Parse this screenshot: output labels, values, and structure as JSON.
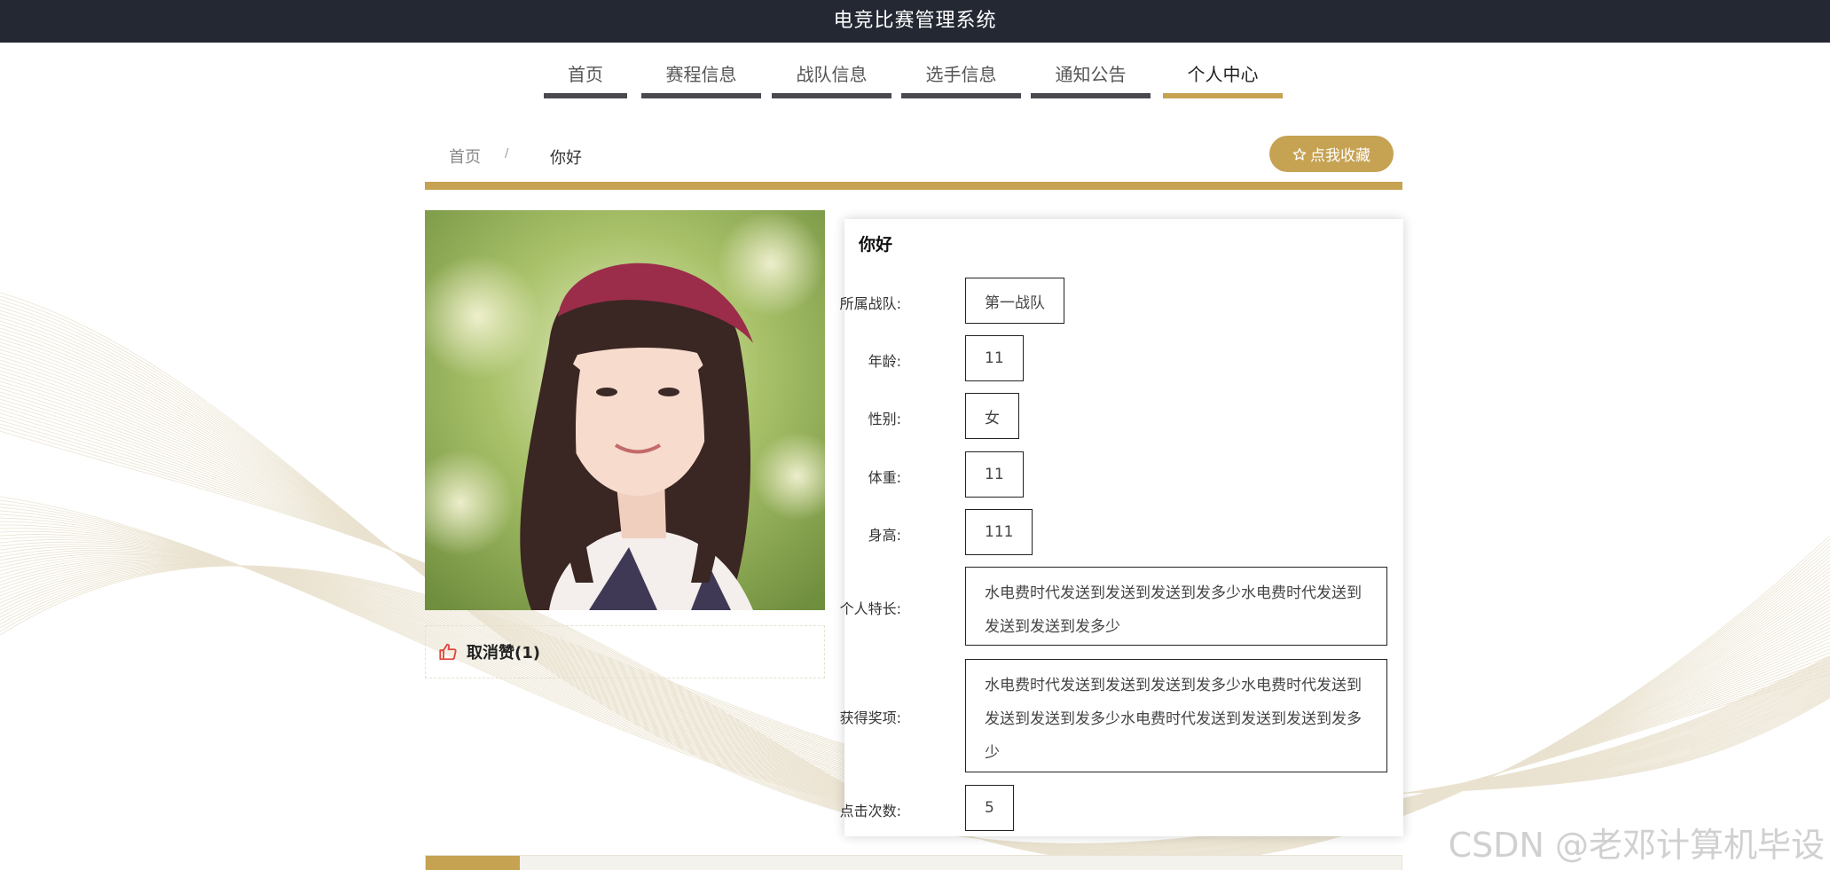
{
  "app": {
    "title": "电竞比赛管理系统"
  },
  "nav": {
    "tabs": [
      {
        "label": "首页",
        "active": false
      },
      {
        "label": "赛程信息",
        "active": false
      },
      {
        "label": "战队信息",
        "active": false
      },
      {
        "label": "选手信息",
        "active": false
      },
      {
        "label": "通知公告",
        "active": false
      },
      {
        "label": "个人中心",
        "active": true
      }
    ]
  },
  "breadcrumb": {
    "home": "首页",
    "separator": "/",
    "current": "你好"
  },
  "favorite": {
    "icon": "star-outline-icon",
    "label": "点我收藏"
  },
  "like": {
    "icon": "thumbs-up-icon",
    "label": "取消赞(1)"
  },
  "profile": {
    "name": "你好",
    "fields": [
      {
        "label": "所属战队:",
        "value": "第一战队"
      },
      {
        "label": "年龄:",
        "value": "11"
      },
      {
        "label": "性别:",
        "value": "女"
      },
      {
        "label": "体重:",
        "value": "11"
      },
      {
        "label": "身高:",
        "value": "111"
      },
      {
        "label": "个人特长:",
        "value": "水电费时代发送到发送到发送到发多少水电费时代发送到发送到发送到发多少"
      },
      {
        "label": "获得奖项:",
        "value": "水电费时代发送到发送到发送到发多少水电费时代发送到发送到发送到发多少水电费时代发送到发送到发送到发多少"
      },
      {
        "label": "点击次数:",
        "value": "5"
      }
    ]
  },
  "colors": {
    "accent": "#c6a253",
    "topbar": "#232833",
    "tab_underline": "#484a4f"
  },
  "watermark": "CSDN @老邓计算机毕设"
}
